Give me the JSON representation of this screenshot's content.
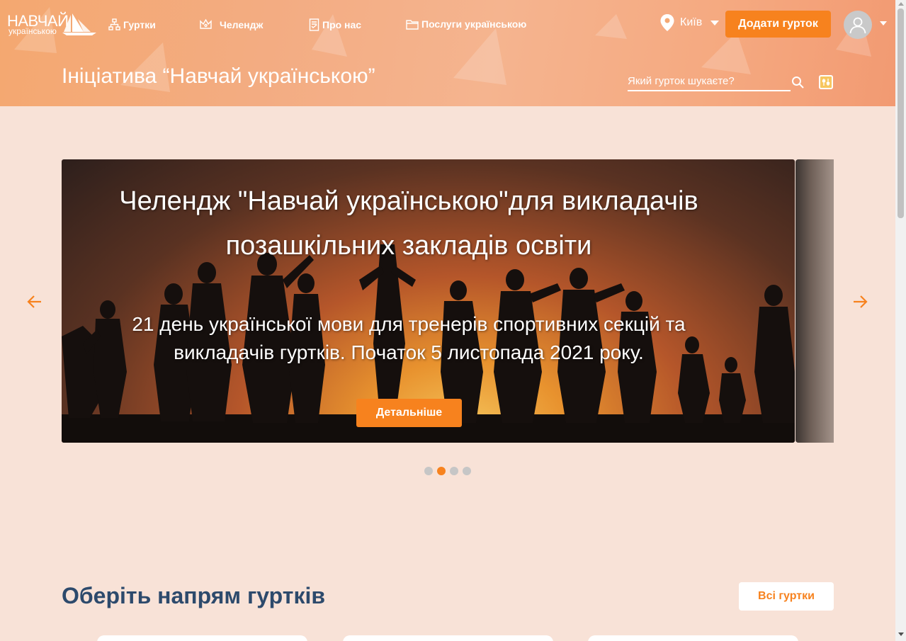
{
  "logo": {
    "line1": "НАВЧАЙ",
    "line2": "українською"
  },
  "nav": [
    {
      "label": "Гуртки",
      "icon": "sitemap-icon"
    },
    {
      "label": "Челендж",
      "icon": "crown-icon"
    },
    {
      "label": "Про нас",
      "icon": "document-icon"
    },
    {
      "label": "Послуги українською",
      "icon": "folder-icon"
    }
  ],
  "city": {
    "label": "Київ",
    "icon": "map-pin-icon"
  },
  "add_club_label": "Додати гурток",
  "page_title": "Ініціатива “Навчай українською”",
  "search": {
    "placeholder": "Який гурток шукаєте?"
  },
  "slider": {
    "title": "Челендж \"Навчай українською\"для викладачів позашкільних закладів освіти",
    "text": "21 день української мови для тренерів спортивних секцій та викладачів гуртків. Початок 5 листопада 2021 року.",
    "button_label": "Детальніше",
    "dots_count": 4,
    "active_dot": 1
  },
  "directions": {
    "title": "Оберіть напрям гуртків",
    "all_button_label": "Всі гуртки"
  },
  "colors": {
    "accent": "#f7821e",
    "heading": "#2d4a6c",
    "page_bg": "#f8e2d7"
  }
}
